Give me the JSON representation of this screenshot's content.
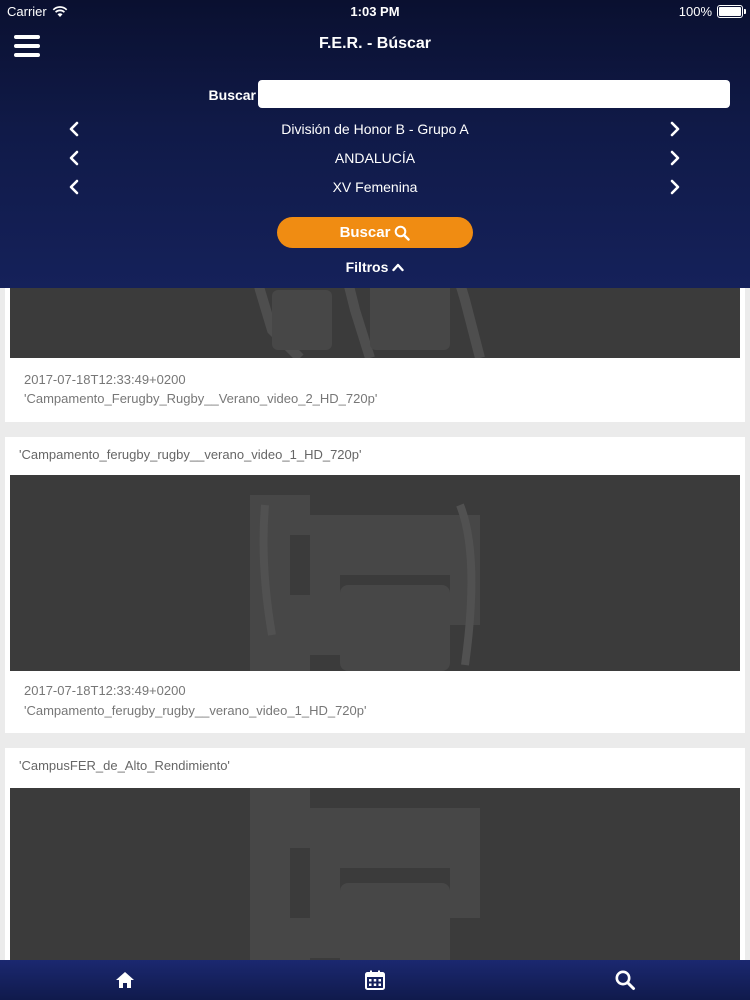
{
  "status_bar": {
    "carrier": "Carrier",
    "time": "1:03 PM",
    "battery": "100%"
  },
  "nav": {
    "title": "F.E.R. - Búscar"
  },
  "search": {
    "label": "Buscar",
    "value": "",
    "placeholder": ""
  },
  "selectors": [
    {
      "value": "División de Honor B - Grupo A"
    },
    {
      "value": "ANDALUCÍA"
    },
    {
      "value": "XV Femenina"
    }
  ],
  "search_button": {
    "label": "Buscar"
  },
  "filters": {
    "label": "Filtros"
  },
  "results": [
    {
      "title": "",
      "date": "2017-07-18T12:33:49+0200",
      "subtitle": "'Campamento_Ferugby_Rugby__Verano_video_2_HD_720p'"
    },
    {
      "title": "'Campamento_ferugby_rugby__verano_video_1_HD_720p'",
      "date": "2017-07-18T12:33:49+0200",
      "subtitle": "'Campamento_ferugby_rugby__verano_video_1_HD_720p'"
    },
    {
      "title": "'CampusFER_de_Alto_Rendimiento'",
      "date": "",
      "subtitle": ""
    }
  ],
  "tabbar": {
    "items": [
      "home-icon",
      "calendar-icon",
      "search-icon"
    ]
  },
  "colors": {
    "header_bg": "#101a48",
    "accent": "#f08c12",
    "thumb_bg": "#3b3b3b",
    "page_bg": "#ebebeb"
  }
}
